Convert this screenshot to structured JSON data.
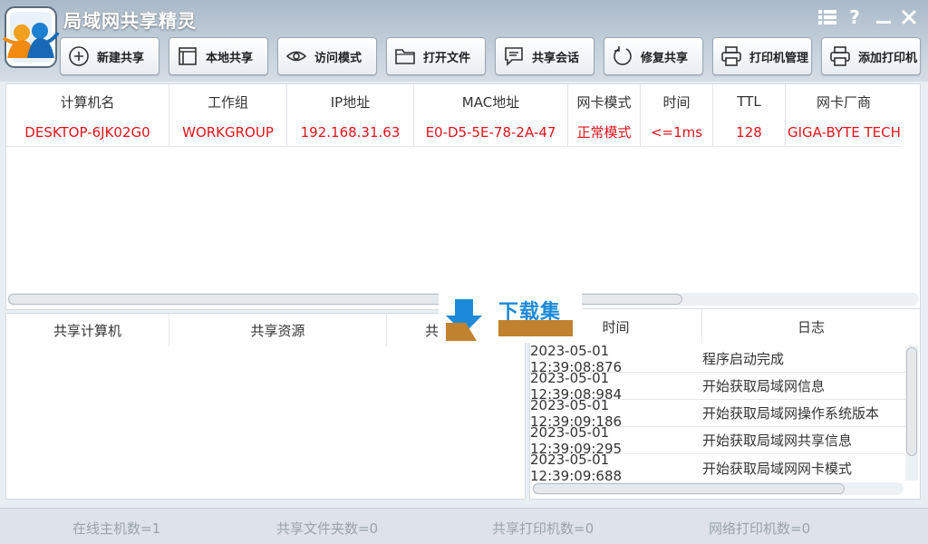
{
  "app": {
    "title": "局域网共享精灵"
  },
  "window_controls": {
    "menu": "☰",
    "help": "?",
    "minimize": "—",
    "close": "✕"
  },
  "toolbar": [
    {
      "label": "新建共享",
      "icon": "plus-circle-icon"
    },
    {
      "label": "本地共享",
      "icon": "window-icon"
    },
    {
      "label": "访问模式",
      "icon": "eye-icon"
    },
    {
      "label": "打开文件",
      "icon": "folder-icon"
    },
    {
      "label": "共享会话",
      "icon": "chat-icon"
    },
    {
      "label": "修复共享",
      "icon": "refresh-icon"
    },
    {
      "label": "打印机管理",
      "icon": "printer-icon"
    },
    {
      "label": "添加打印机",
      "icon": "printer-add-icon"
    }
  ],
  "hosts_table": {
    "columns": [
      "计算机名",
      "工作组",
      "IP地址",
      "MAC地址",
      "网卡模式",
      "时间",
      "TTL",
      "网卡厂商"
    ],
    "rows": [
      [
        "DESKTOP-6JK02G0",
        "WORKGROUP",
        "192.168.31.63",
        "E0-D5-5E-78-2A-47",
        "正常模式",
        "<=1ms",
        "128",
        "GIGA-BYTE TECHNOLOGY CO.,LTD."
      ]
    ]
  },
  "shares_table": {
    "columns": [
      "共享计算机",
      "共享资源",
      "共"
    ]
  },
  "log_table": {
    "columns": [
      "时间",
      "日志"
    ],
    "rows": [
      [
        "2023-05-01 12:39:08:876",
        "程序启动完成"
      ],
      [
        "2023-05-01 12:39:08:984",
        "开始获取局域网信息"
      ],
      [
        "2023-05-01 12:39:09:186",
        "开始获取局域网操作系统版本"
      ],
      [
        "2023-05-01 12:39:09:295",
        "开始获取局域网共享信息"
      ],
      [
        "2023-05-01 12:39:09:688",
        "开始获取局域网网卡模式"
      ]
    ]
  },
  "status": {
    "online_hosts": "在线主机数=1",
    "shared_folders": "共享文件夹数=0",
    "shared_printers": "共享打印机数=0",
    "network_printers": "网络打印机数=0"
  },
  "watermark": {
    "text": "下载集"
  },
  "colors": {
    "row_highlight": "#e0141c",
    "watermark_blue": "#1b8ad8",
    "watermark_brown": "#c0822f"
  }
}
